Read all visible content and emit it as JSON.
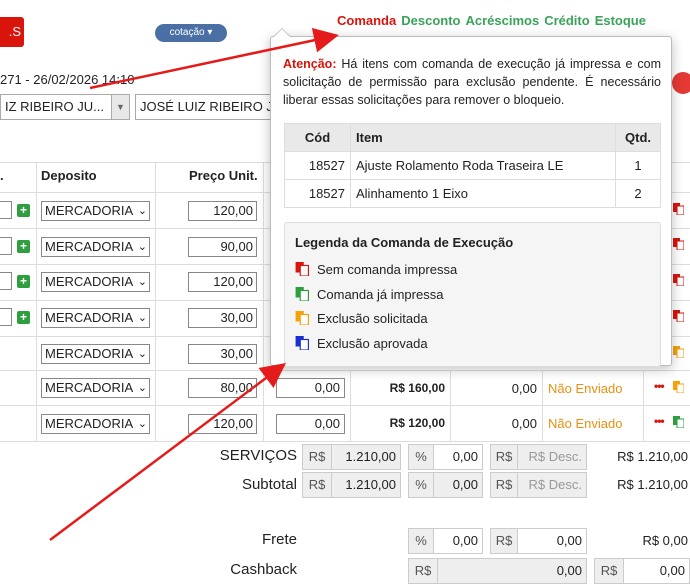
{
  "header": {
    "red_button": ".S",
    "cotacao": "cotação ▾",
    "links": [
      "Comanda",
      "Desconto",
      "Acréscimos",
      "Crédito",
      "Estoque"
    ],
    "date_text": "271 - 26/02/2026 14:10",
    "client_select": "IZ RIBEIRO JU...",
    "client_name": "JOSÉ LUIZ RIBEIRO J"
  },
  "table": {
    "col_qty": ".",
    "col_deposito": "Deposito",
    "col_preco": "Preço Unit.",
    "rows": [
      {
        "deposito": "MERCADORIA",
        "preco": "120,00"
      },
      {
        "deposito": "MERCADORIA",
        "preco": "90,00"
      },
      {
        "deposito": "MERCADORIA",
        "preco": "120,00"
      },
      {
        "deposito": "MERCADORIA",
        "preco": "30,00"
      },
      {
        "deposito": "MERCADORIA",
        "preco": "30,00"
      },
      {
        "deposito": "MERCADORIA",
        "preco": "80,00",
        "desc": "0,00",
        "total": "R$ 160,00",
        "val": "0,00",
        "status": "Não Enviado"
      },
      {
        "deposito": "MERCADORIA",
        "preco": "120,00",
        "desc": "0,00",
        "total": "R$ 120,00",
        "val": "0,00",
        "status": "Não Enviado"
      }
    ]
  },
  "summary": {
    "servicos_label": "SERVIÇOS",
    "subtotal_label": "Subtotal",
    "frete_label": "Frete",
    "cashback_label": "Cashback",
    "rs": "R$",
    "pct": "%",
    "servicos_value": "1.210,00",
    "servicos_pct": "0,00",
    "desc_placeholder": "R$ Desc.",
    "servicos_total": "R$ 1.210,00",
    "subtotal_value": "1.210,00",
    "subtotal_pct": "0,00",
    "subtotal_total": "R$ 1.210,00",
    "frete_pct": "0,00",
    "frete_value": "0,00",
    "frete_total": "R$ 0,00",
    "cashback_value": "0,00",
    "cashback_value2": "0,00"
  },
  "popover": {
    "warning_label": "Atenção:",
    "warning_text": " Há itens com comanda de execução já impressa e com solicitação de permissão para exclusão pendente. É necessário liberar essas solicitações para remover o bloqueio.",
    "col_cod": "Cód",
    "col_item": "Item",
    "col_qtd": "Qtd.",
    "items": [
      {
        "cod": "18527",
        "item": "Ajuste Rolamento Roda Traseira LE",
        "qtd": "1"
      },
      {
        "cod": "18527",
        "item": "Alinhamento 1 Eixo",
        "qtd": "2"
      }
    ],
    "legend_title": "Legenda da Comanda de Execução",
    "legend": [
      {
        "label": "Sem comanda impressa",
        "color": "#d9140c"
      },
      {
        "label": "Comanda já impressa",
        "color": "#2e9e3e"
      },
      {
        "label": "Exclusão solicitada",
        "color": "#f5a10a"
      },
      {
        "label": "Exclusão aprovada",
        "color": "#1a2fd0"
      }
    ]
  },
  "colors": {
    "red": "#d9140c",
    "green": "#3aa35a",
    "orange": "#e8910f",
    "blue": "#1a2fd0"
  }
}
